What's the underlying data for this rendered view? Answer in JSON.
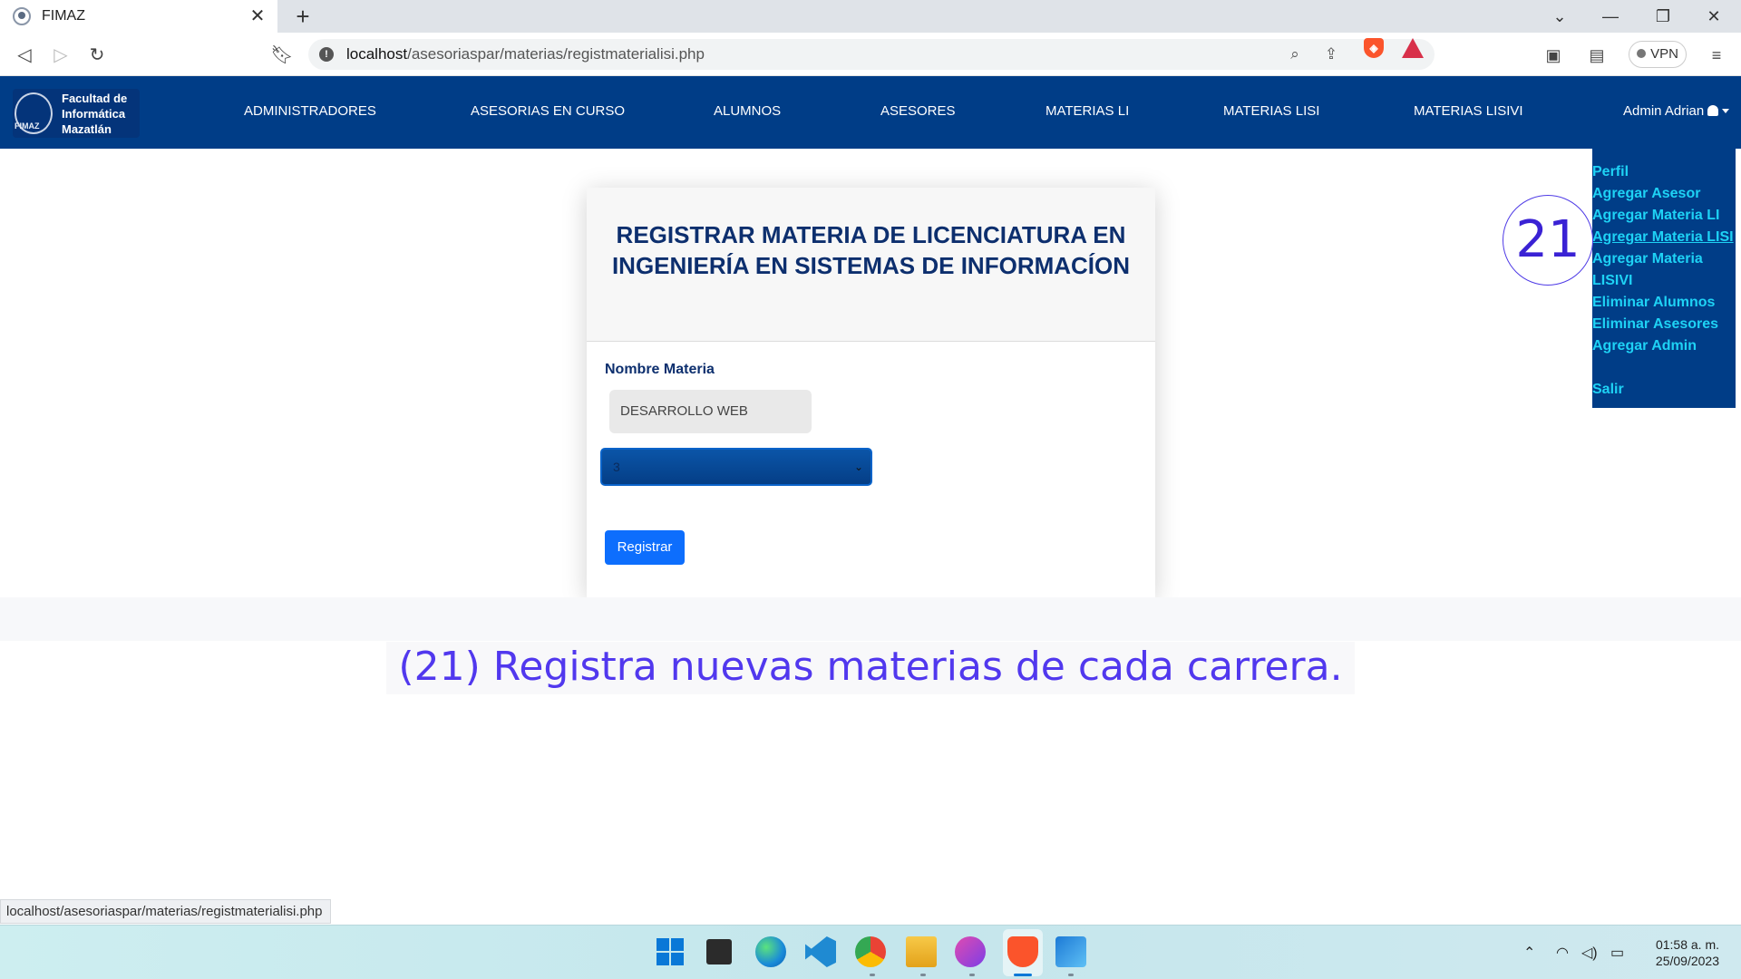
{
  "browser": {
    "tab_title": "FIMAZ",
    "url_host": "localhost",
    "url_path": "/asesoriaspar/materias/registmaterialisi.php",
    "vpn_label": "VPN",
    "status_url": "localhost/asesoriaspar/materias/registmaterialisi.php"
  },
  "site": {
    "logo_text": [
      "Facultad de",
      "Informática",
      "Mazatlán"
    ],
    "nav": [
      "ADMINISTRADORES",
      "ASESORIAS EN CURSO",
      "ALUMNOS",
      "ASESORES",
      "MATERIAS LI",
      "MATERIAS LISI",
      "MATERIAS LISIVI"
    ],
    "user_label": "Admin Adrian",
    "dropdown": [
      "Perfil",
      "Agregar Asesor",
      "Agregar Materia LI",
      "Agregar Materia LISI",
      "Agregar Materia LISIVI",
      "Eliminar Alumnos",
      "Eliminar Asesores",
      "Agregar Admin",
      "Salir"
    ]
  },
  "form": {
    "title": "REGISTRAR MATERIA DE LICENCIATURA EN INGENIERÍA EN SISTEMAS DE INFORMACÍON",
    "name_label": "Nombre Materia",
    "name_value": "DESARROLLO WEB",
    "select_value": "3",
    "submit_label": "Registrar"
  },
  "annotation": {
    "number": "21",
    "caption": "(21) Registra nuevas materias de cada carrera."
  },
  "taskbar": {
    "time": "01:58 a. m.",
    "date": "25/09/2023"
  },
  "colors": {
    "navbar": "#003d87",
    "dropdown_link": "#1ed2f5",
    "title_text": "#0d2f6e",
    "button": "#0d6efd",
    "annotation": "#5138ee"
  }
}
